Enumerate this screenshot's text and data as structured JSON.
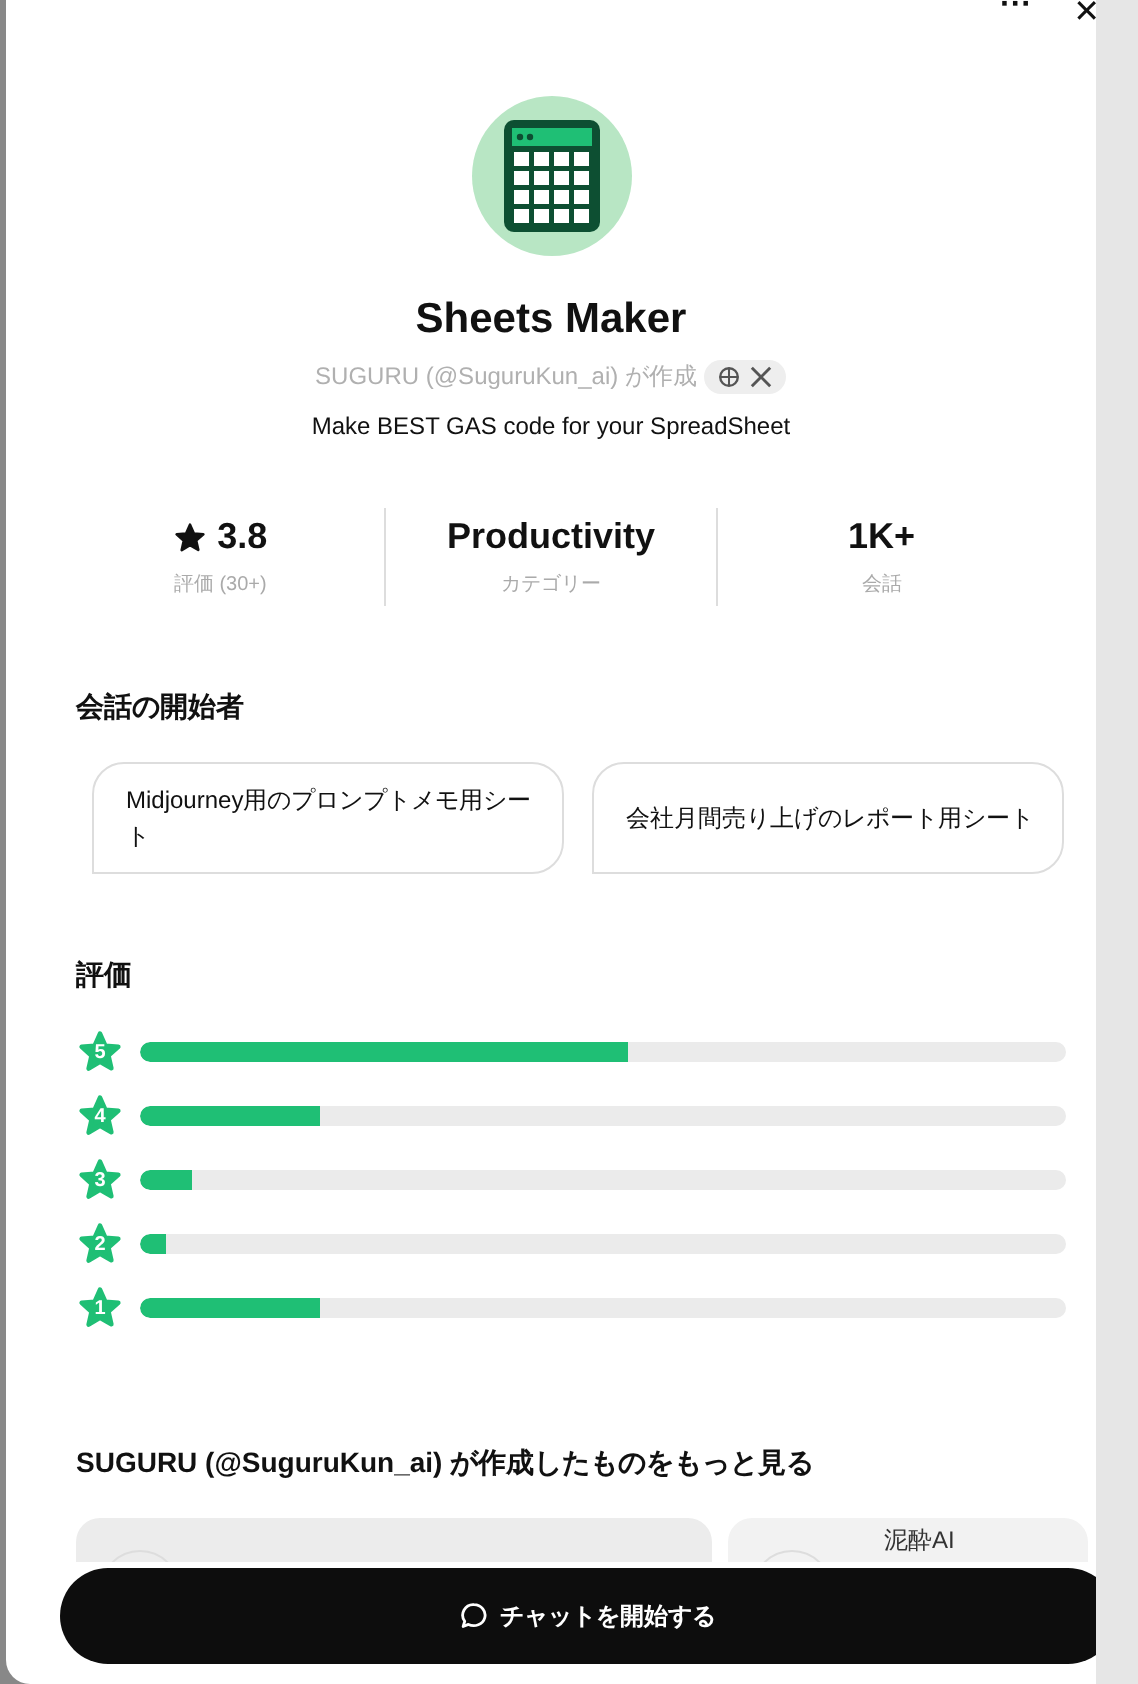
{
  "top_bar": {
    "more_icon": "···",
    "close_icon": "✕"
  },
  "profile": {
    "name": "Sheets Maker",
    "author": "SUGURU (@SuguruKun_ai) が作成",
    "description": "Make BEST GAS code for your SpreadSheet"
  },
  "stats": [
    {
      "kind": "rating",
      "value": "3.8",
      "label": "評価 (30+)"
    },
    {
      "kind": "plain",
      "value": "Productivity",
      "label": "カテゴリー"
    },
    {
      "kind": "plain",
      "value": "1K+",
      "label": "会話"
    }
  ],
  "starters": {
    "title": "会話の開始者",
    "items": [
      "Midjourney用のプロンプトメモ用シート",
      "会社月間売り上げのレポート用シート"
    ]
  },
  "ratings": {
    "title": "評価",
    "rows": [
      {
        "star": "5",
        "level": 0.527
      },
      {
        "star": "4",
        "level": 0.194
      },
      {
        "star": "3",
        "level": 0.056
      },
      {
        "star": "2",
        "level": 0.028
      },
      {
        "star": "1",
        "level": 0.194
      }
    ]
  },
  "more": {
    "title": "SUGURU (@SuguruKun_ai) が作成したものをもっと見る",
    "cards": [
      {
        "kind": "blank"
      },
      {
        "kind": "named",
        "name": "泥酔AI"
      }
    ]
  },
  "chat_button": {
    "label": "チャットを開始する"
  }
}
